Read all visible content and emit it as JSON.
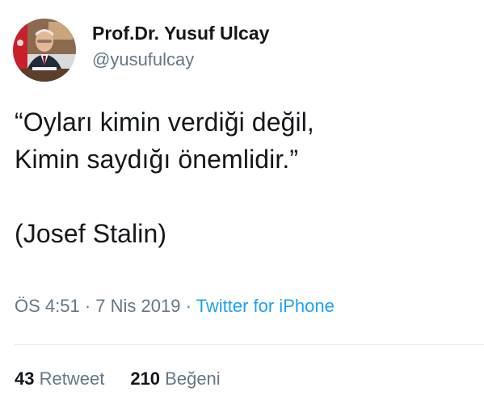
{
  "user": {
    "display_name": "Prof.Dr. Yusuf Ulcay",
    "handle": "@yusufulcay",
    "avatar_icon": "profile-photo"
  },
  "tweet": {
    "text": "“Oyları kimin verdiği değil,\nKimin saydığı önemlidir.”\n\n(Josef Stalin)"
  },
  "meta": {
    "time": "ÖS 4:51",
    "separator": " · ",
    "date": "7 Nis 2019",
    "source": "Twitter for iPhone"
  },
  "stats": {
    "retweets_count": "43",
    "retweets_label": "Retweet",
    "likes_count": "210",
    "likes_label": "Beğeni"
  },
  "colors": {
    "text": "#14171a",
    "secondary": "#657786",
    "link": "#1da1f2",
    "divider": "#e6ecf0"
  }
}
